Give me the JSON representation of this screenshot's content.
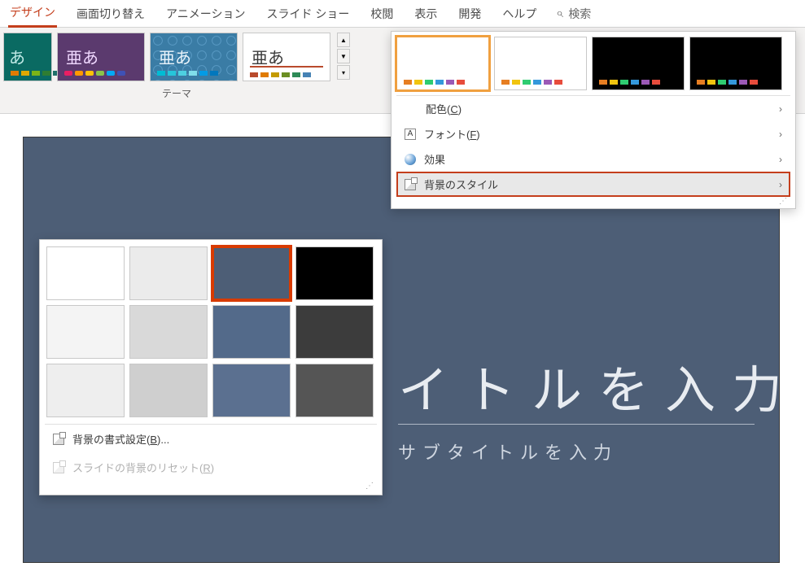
{
  "tabs": {
    "design": "デザイン",
    "transitions": "画面切り替え",
    "animations": "アニメーション",
    "slideshow": "スライド ショー",
    "review": "校閲",
    "view": "表示",
    "developer": "開発",
    "help": "ヘルプ"
  },
  "search": {
    "placeholder": "検索"
  },
  "themes": {
    "group_label": "テーマ",
    "sample_text_a": "あ",
    "sample_text_ja": "亜あ"
  },
  "variants_menu": {
    "colors": "配色(",
    "colors_key": "C",
    "colors_suffix": ")",
    "fonts": "フォント(",
    "fonts_key": "F",
    "fonts_suffix": ")",
    "effects": "効果",
    "bg_styles": "背景のスタイル"
  },
  "bg_flyout": {
    "format_bg": "背景の書式設定(",
    "format_bg_key": "B",
    "format_bg_suffix": ")...",
    "reset_bg": "スライドの背景のリセット(",
    "reset_bg_key": "R",
    "reset_bg_suffix": ")",
    "styles": [
      {
        "bg": "#ffffff",
        "selected": false
      },
      {
        "bg": "#ebebeb",
        "selected": false
      },
      {
        "bg": "#4d5e76",
        "selected": true
      },
      {
        "bg": "#000000",
        "selected": false
      },
      {
        "bg": "#f4f4f4",
        "selected": false
      },
      {
        "bg": "#d9d9d9",
        "selected": false
      },
      {
        "bg": "#536a8a",
        "selected": false
      },
      {
        "bg": "#3c3c3c",
        "selected": false
      },
      {
        "bg": "#eeeeee",
        "selected": false
      },
      {
        "bg": "#cfcfcf",
        "selected": false
      },
      {
        "bg": "#5b7090",
        "selected": false
      },
      {
        "bg": "#555555",
        "selected": false
      }
    ]
  },
  "slide": {
    "title_placeholder": "イトルを入力",
    "subtitle_placeholder": "サブタイトルを入力"
  }
}
